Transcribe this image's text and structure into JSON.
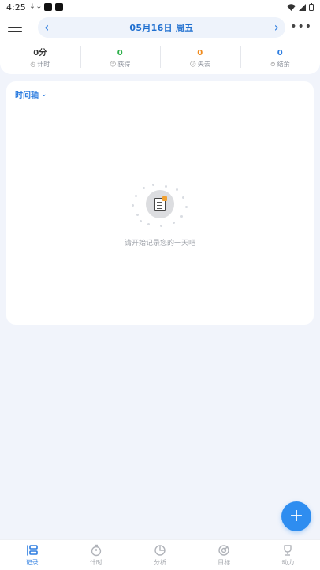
{
  "status_bar": {
    "time": "4:25"
  },
  "header": {
    "date": "05月16日 周五"
  },
  "stats": [
    {
      "value": "0分",
      "label": "计时",
      "color": "#333333",
      "icon": "clock-icon"
    },
    {
      "value": "0",
      "label": "获得",
      "color": "#2DB04A",
      "icon": "smile-icon"
    },
    {
      "value": "0",
      "label": "失去",
      "color": "#F08A1C",
      "icon": "sad-icon"
    },
    {
      "value": "0",
      "label": "结余",
      "color": "#2D7DE0",
      "icon": "balance-icon"
    }
  ],
  "card": {
    "timeline_label": "时间轴",
    "empty_text": "请开始记录您的一天吧"
  },
  "fab": {
    "label": "+"
  },
  "bottom_nav": [
    {
      "label": "记录",
      "icon": "record-icon",
      "active": true
    },
    {
      "label": "计时",
      "icon": "timer-icon",
      "active": false
    },
    {
      "label": "分析",
      "icon": "pie-chart-icon",
      "active": false
    },
    {
      "label": "目标",
      "icon": "target-icon",
      "active": false
    },
    {
      "label": "动力",
      "icon": "trophy-icon",
      "active": false
    }
  ],
  "colors": {
    "accent": "#2D7DE0",
    "background": "#F1F4FB",
    "fab": "#2E8DF0"
  }
}
